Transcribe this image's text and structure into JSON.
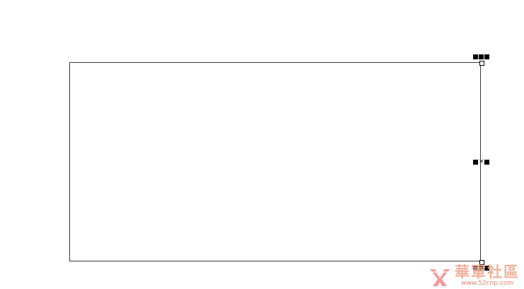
{
  "icons": {
    "handle": "square-handle-icon",
    "anchor": "hollow-anchor-icon",
    "center_mark": "x-mark-icon",
    "logo": "ribbon-logo-icon"
  },
  "center_glyph": "×",
  "watermark": {
    "title": "華軍社區",
    "url": "www.52cnp.com"
  },
  "colors": {
    "outline": "#3a3a3a",
    "handle": "#000000",
    "watermark_title": "#f2b19c",
    "watermark_url": "#e48a6e"
  }
}
